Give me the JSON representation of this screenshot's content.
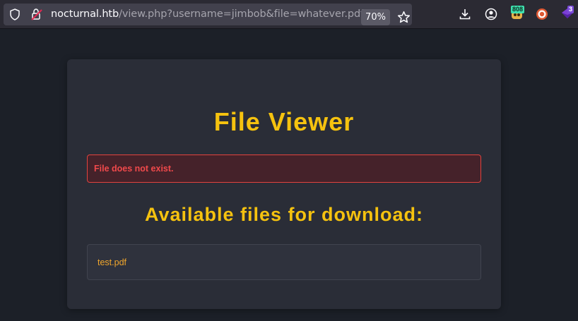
{
  "browser": {
    "url_host": "nocturnal.htb",
    "url_path": "/view.php?username=jimbob&file=whatever.pdf",
    "zoom": "70%",
    "extensions": [
      {
        "name": "tampermonkey-icon",
        "badge": "808"
      },
      {
        "name": "duckduckgo-icon",
        "badge": ""
      },
      {
        "name": "purple-extension-icon",
        "badge": "3"
      }
    ]
  },
  "page": {
    "title": "File Viewer",
    "error_message": "File does not exist.",
    "subtitle": "Available files for download:",
    "files": [
      "test.pdf"
    ]
  },
  "colors": {
    "accent": "#f5c20f",
    "error": "#f0494b",
    "link": "#f2a72c",
    "background": "#1c2028",
    "card": "#2a2d37"
  }
}
